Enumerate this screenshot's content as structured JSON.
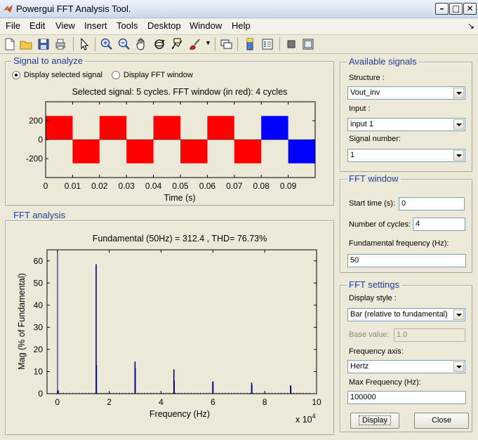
{
  "window": {
    "title": "Powergui FFT Analysis Tool."
  },
  "menu": [
    "File",
    "Edit",
    "View",
    "Insert",
    "Tools",
    "Desktop",
    "Window",
    "Help"
  ],
  "toolbar": [
    "new-file-icon",
    "open-folder-icon",
    "save-icon",
    "print-icon",
    "pointer-icon",
    "zoom-in-icon",
    "zoom-out-icon",
    "pan-hand-icon",
    "rotate-icon",
    "data-cursor-icon",
    "brush-icon",
    "brush-dropdown-icon",
    "link-icon",
    "colorbar-icon",
    "legend-icon",
    "hide-plot-tools-icon",
    "show-plot-tools-icon"
  ],
  "signal_panel": {
    "title": "Signal to analyze",
    "radio_selected": "Display selected signal",
    "radio_fft": "Display FFT window"
  },
  "fft_analysis_panel": {
    "title": "FFT analysis"
  },
  "available_signals": {
    "title": "Available signals",
    "structure_label": "Structure :",
    "structure_value": "Vout_inv",
    "input_label": "Input :",
    "input_value": "input 1",
    "signal_number_label": "Signal number:",
    "signal_number_value": "1"
  },
  "fft_window": {
    "title": "FFT window",
    "start_time_label": "Start time (s):",
    "start_time_value": "0",
    "cycles_label": "Number of cycles:",
    "cycles_value": "4",
    "fundamental_label": "Fundamental frequency (Hz):",
    "fundamental_value": "50"
  },
  "fft_settings": {
    "title": "FFT settings",
    "display_style_label": "Display style :",
    "display_style_value": "Bar (relative to fundamental)",
    "base_value_label": "Base value:",
    "base_value_value": "1.0",
    "freq_axis_label": "Frequency axis:",
    "freq_axis_value": "Hertz",
    "max_freq_label": "Max Frequency (Hz):",
    "max_freq_value": "100000"
  },
  "buttons": {
    "display": "Display",
    "close": "Close"
  },
  "colors": {
    "panel_title": "#1f3c9e",
    "signal_red": "#ff0000",
    "signal_blue": "#0000ff",
    "fft_bar": "#00007f"
  },
  "chart_data": [
    {
      "type": "line",
      "title": "Selected signal: 5 cycles. FFT window (in red): 4 cycles",
      "xlabel": "Time (s)",
      "ylabel": "",
      "xlim": [
        0,
        0.1
      ],
      "ylim": [
        -400,
        400
      ],
      "x_ticks": [
        "0",
        "0.01",
        "0.02",
        "0.03",
        "0.04",
        "0.05",
        "0.06",
        "0.07",
        "0.08",
        "0.09"
      ],
      "y_ticks": [
        "200",
        "0",
        "-200"
      ],
      "waveform": "square",
      "amplitude": 250,
      "period_s": 0.02,
      "series": [
        {
          "segment": "FFT window",
          "x_range": [
            0,
            0.08
          ],
          "color": "#ff0000"
        },
        {
          "segment": "remaining signal",
          "x_range": [
            0.08,
            0.1
          ],
          "color": "#0000ff"
        }
      ]
    },
    {
      "type": "bar",
      "title": "Fundamental (50Hz) = 312.4 , THD= 76.73%",
      "xlabel": "Frequency (Hz)",
      "ylabel": "Mag (% of Fundamental)",
      "x_multiplier": "x 10",
      "x_multiplier_exp": "4",
      "xlim": [
        -4000,
        100000
      ],
      "ylim": [
        0,
        65
      ],
      "x_ticks": [
        "0",
        "2",
        "4",
        "6",
        "8",
        "10"
      ],
      "y_ticks": [
        "0",
        "10",
        "20",
        "30",
        "40",
        "50",
        "60"
      ],
      "x": [
        300,
        14950,
        15050,
        29950,
        30050,
        44950,
        45050,
        59950,
        60050,
        74950,
        75050,
        89950,
        90050
      ],
      "values": [
        1.5,
        58.5,
        13,
        14.5,
        11.5,
        11,
        6,
        5.5,
        5.5,
        5,
        4,
        3.8,
        3.5
      ]
    }
  ]
}
